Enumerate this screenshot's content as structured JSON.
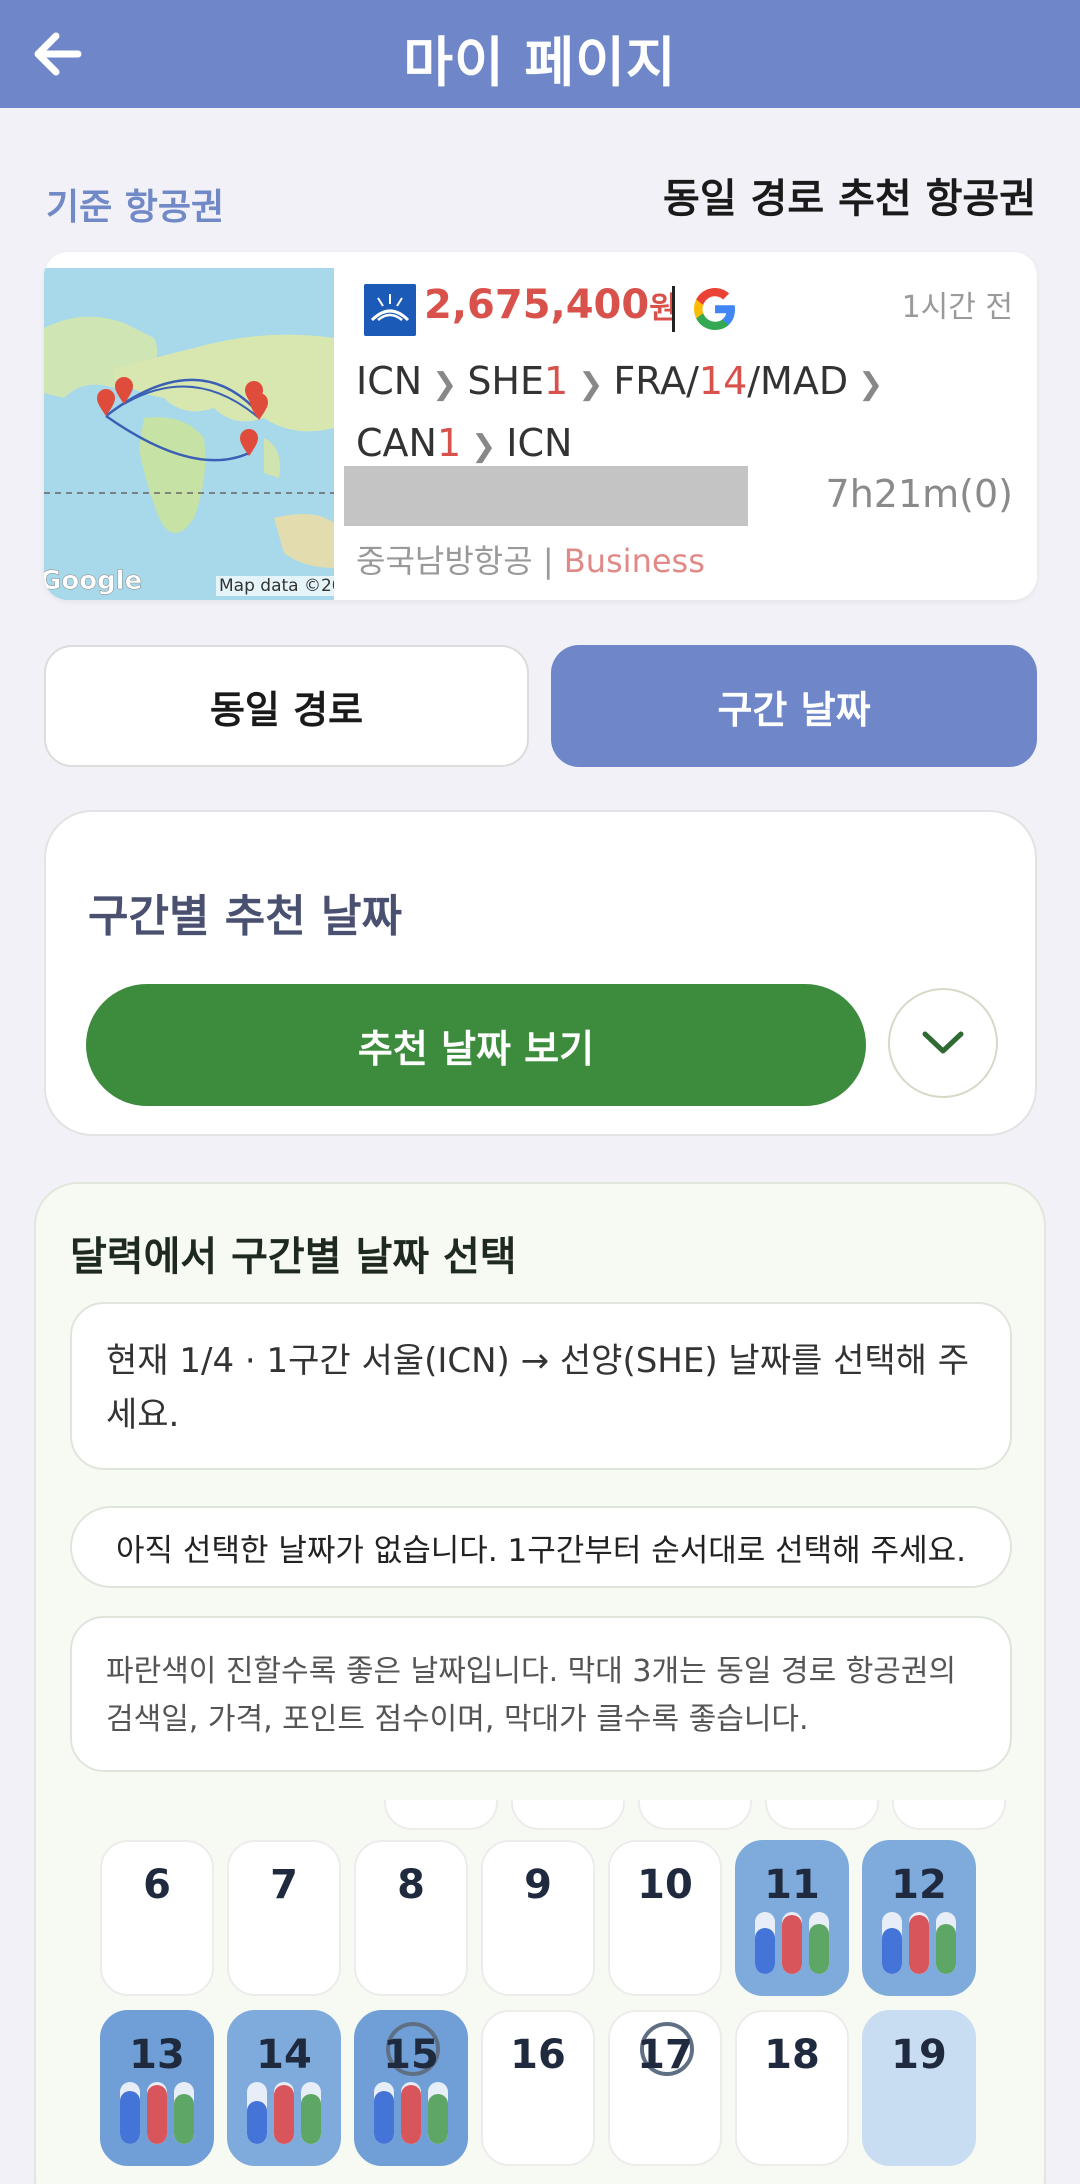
{
  "header": {
    "title": "마이 페이지",
    "back": "arrow-left-icon"
  },
  "labels": {
    "base": "기준 항공권",
    "same_route": "동일 경로 추천 항공권"
  },
  "ticket": {
    "price_amount": "2,675,400",
    "price_unit": "원",
    "time_ago": "1시간 전",
    "route": [
      {
        "code": "ICN",
        "n": ""
      },
      {
        "code": "SHE",
        "n": "1"
      },
      {
        "code": "FRA/",
        "n": "14",
        "tail": "/MAD"
      },
      {
        "code": "CAN",
        "n": "1"
      },
      {
        "code": "ICN",
        "n": ""
      }
    ],
    "duration": "7h21m(0)",
    "carrier": "중국남방항공",
    "cabin": "Business",
    "map_brand": "Google",
    "map_credit": "Map data ©20"
  },
  "tabs": {
    "left": "동일 경로",
    "right": "구간 날짜"
  },
  "recommend": {
    "title": "구간별 추천 날짜",
    "button": "추천 날짜 보기"
  },
  "calendar": {
    "title": "달력에서 구간별 날짜 선택",
    "current": "현재 1/4 · 1구간 서울(ICN) → 선양(SHE) 날짜를 선택해 주세요.",
    "none": "아직 선택한 날짜가 없습니다. 1구간부터 순서대로 선택해 주세요.",
    "legend": "파란색이 진할수록 좋은 날짜입니다. 막대 3개는 동일 경로 항공권의 검색일, 가격, 포인트 점수이며, 막대가 클수록 좋습니다.",
    "days": [
      {
        "num": "6",
        "shade": "none",
        "bars": null,
        "ring": false
      },
      {
        "num": "7",
        "shade": "none",
        "bars": null,
        "ring": false
      },
      {
        "num": "8",
        "shade": "none",
        "bars": null,
        "ring": false
      },
      {
        "num": "9",
        "shade": "none",
        "bars": null,
        "ring": false
      },
      {
        "num": "10",
        "shade": "none",
        "bars": null,
        "ring": false
      },
      {
        "num": "11",
        "shade": "b2",
        "bars": [
          0.75,
          0.95,
          0.8
        ],
        "ring": false
      },
      {
        "num": "12",
        "shade": "b2",
        "bars": [
          0.75,
          0.95,
          0.8
        ],
        "ring": false
      },
      {
        "num": "13",
        "shade": "b3",
        "bars": [
          0.85,
          0.95,
          0.8
        ],
        "ring": false
      },
      {
        "num": "14",
        "shade": "b2",
        "bars": [
          0.7,
          0.95,
          0.8
        ],
        "ring": false
      },
      {
        "num": "15",
        "shade": "b3",
        "bars": [
          0.85,
          0.95,
          0.8
        ],
        "ring": true
      },
      {
        "num": "16",
        "shade": "none",
        "bars": null,
        "ring": false
      },
      {
        "num": "17",
        "shade": "none",
        "bars": null,
        "ring": true
      },
      {
        "num": "18",
        "shade": "none",
        "bars": null,
        "ring": false
      },
      {
        "num": "19",
        "shade": "b1",
        "bars": null,
        "ring": false
      }
    ]
  }
}
